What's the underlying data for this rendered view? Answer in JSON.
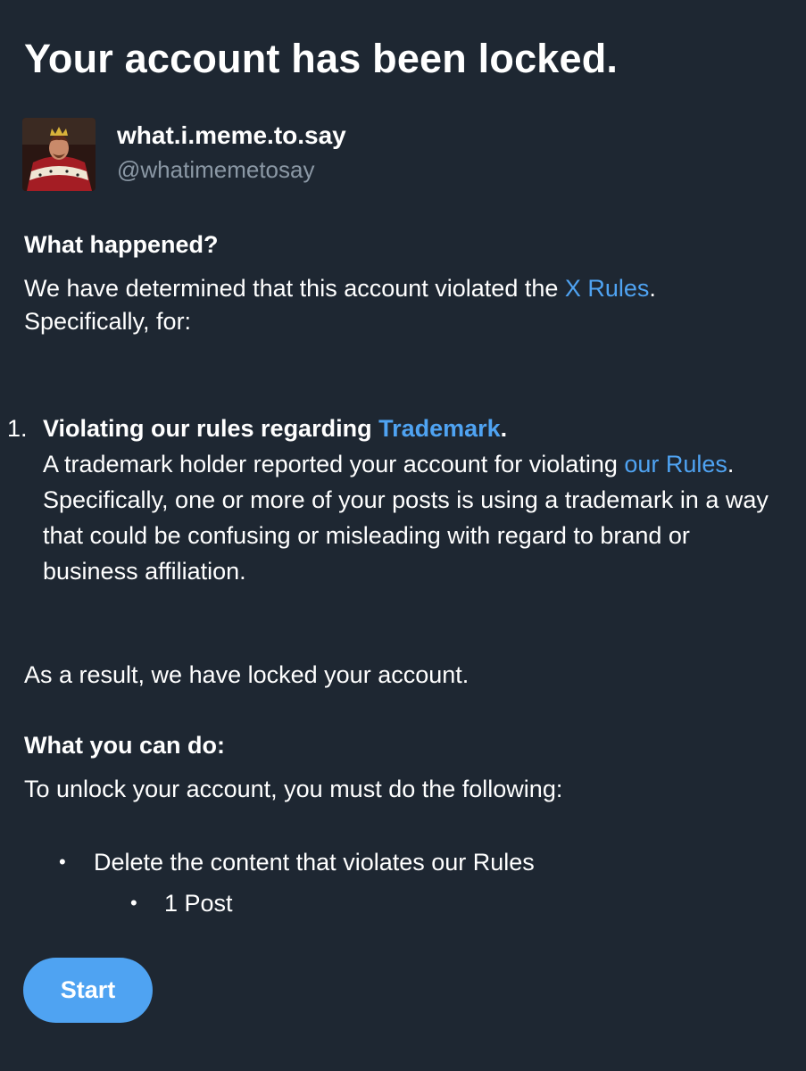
{
  "title": "Your account has been locked.",
  "account": {
    "display_name": "what.i.meme.to.say",
    "handle": "@whatimemetosay",
    "avatar_icon": "king-portrait-avatar"
  },
  "what_happened": {
    "heading": "What happened?",
    "intro_prefix": "We have determined that this account violated the ",
    "rules_link": "X Rules",
    "intro_suffix": ".",
    "specifically": "Specifically, for:"
  },
  "violations": [
    {
      "number": "1.",
      "title_prefix": "Violating our rules regarding ",
      "title_link": "Trademark",
      "title_suffix": ".",
      "desc_prefix": "A trademark holder reported your account for violating ",
      "desc_link": "our Rules",
      "desc_suffix": ". Specifically, one or more of your posts is using a trademark in a way that could be confusing or misleading with regard to brand or business affiliation."
    }
  ],
  "result_text": "As a result, we have locked your account.",
  "what_you_can_do": {
    "heading": "What you can do:",
    "instruction": "To unlock your account, you must do the following:",
    "steps": [
      {
        "label": "Delete the content that violates our Rules",
        "sub": [
          "1 Post"
        ]
      }
    ]
  },
  "start_button": "Start",
  "colors": {
    "background": "#1e2732",
    "link": "#4fa3f2",
    "secondary_text": "#8b98a5",
    "button": "#4fa3f2"
  }
}
